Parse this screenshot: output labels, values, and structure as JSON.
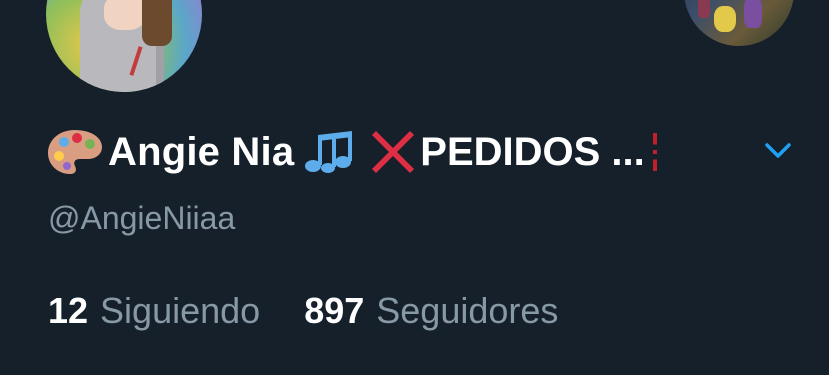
{
  "profile": {
    "display_name": "Angie Nia",
    "name_tail": "PEDIDOS ...",
    "handle": "@AngieNiiaa",
    "emojis": [
      "artist-palette",
      "musical-notes",
      "cross-mark"
    ]
  },
  "stats": {
    "following_count": "12",
    "following_label": "Siguiendo",
    "followers_count": "897",
    "followers_label": "Seguidores"
  },
  "colors": {
    "background": "#15202b",
    "text_primary": "#ffffff",
    "text_secondary": "#8899a6",
    "accent": "#1da1f2",
    "cross_red": "#dd2e44"
  }
}
